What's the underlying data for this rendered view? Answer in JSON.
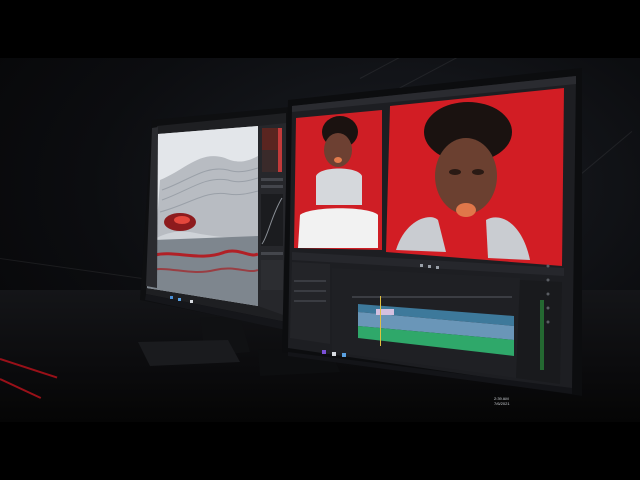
{
  "photo": {
    "subject": "Two monitors on a dark desk; left screen shows a photo editor with a 3D render, right screen shows a video editor with a portrait on red backdrop",
    "colors": {
      "backdrop_red": "#d21d24",
      "bezel": "#111214",
      "ui_dark": "#1f2024",
      "skin": "#6b4030",
      "timeline_green": "#2fa86a",
      "timeline_blue": "#6a96b8"
    }
  },
  "left_monitor": {
    "window_title": "",
    "taskbar_time": ""
  },
  "right_monitor": {
    "taskbar_time": "2:39 AM",
    "taskbar_date": "7/6/2021"
  }
}
